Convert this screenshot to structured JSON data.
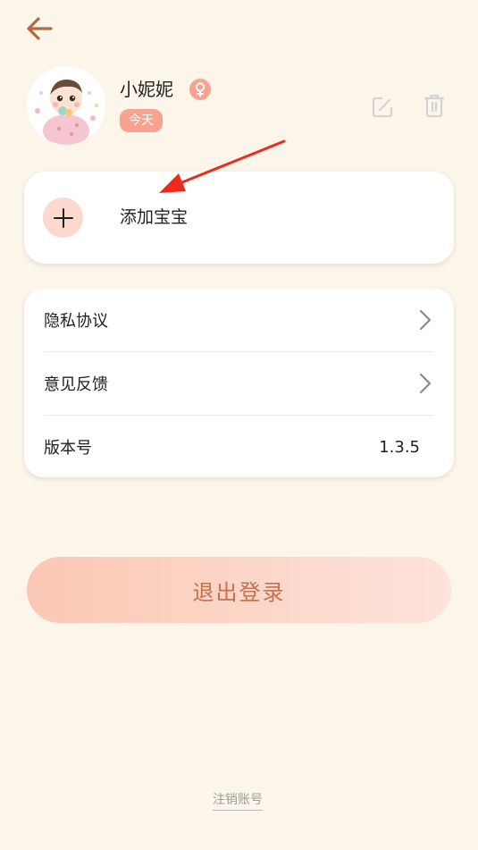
{
  "header": {
    "back_icon": "back-arrow-icon"
  },
  "profile": {
    "name": "小妮妮",
    "gender_icon": "female-icon",
    "age_badge": "今天",
    "edit_icon": "edit-icon",
    "delete_icon": "trash-icon"
  },
  "add_baby": {
    "icon": "plus-icon",
    "label": "添加宝宝"
  },
  "menu": {
    "privacy_label": "隐私协议",
    "feedback_label": "意见反馈",
    "version_label": "版本号",
    "version_value": "1.3.5"
  },
  "logout": {
    "label": "退出登录"
  },
  "footer": {
    "cancel_account": "注销账号"
  },
  "colors": {
    "background": "#fcf6ea",
    "accent": "#f7a38f",
    "back_arrow": "#b8693f",
    "logout_text": "#c2724d"
  }
}
